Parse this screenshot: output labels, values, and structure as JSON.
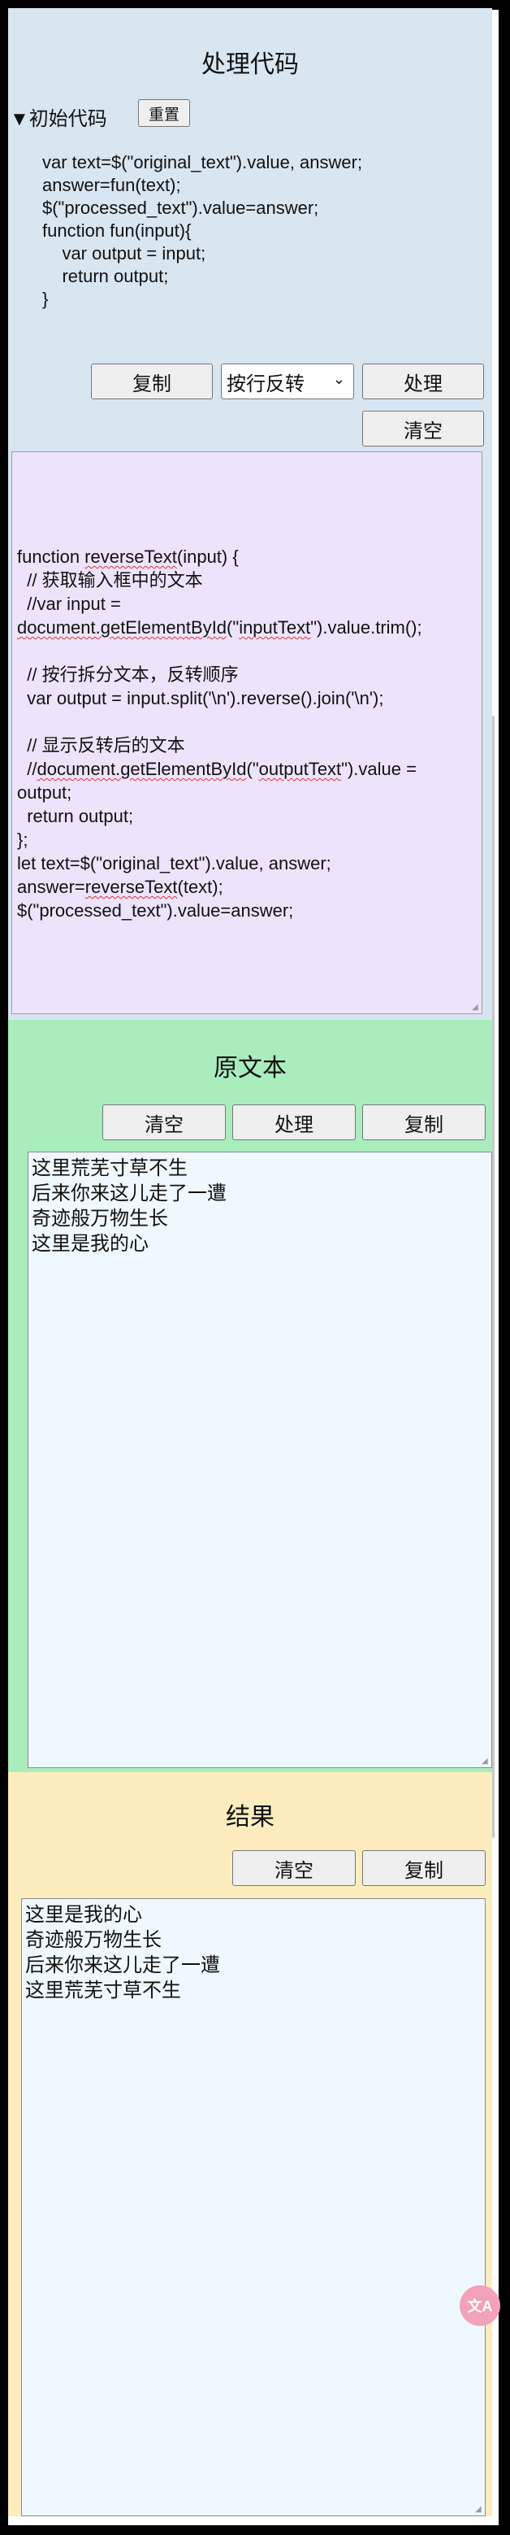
{
  "processing": {
    "title": "处理代码",
    "summary_label": "初始代码",
    "reset_label": "重置",
    "initial_code": "var text=$(\"original_text\").value, answer;\nanswer=fun(text);\n$(\"processed_text\").value=answer;\nfunction fun(input){\n    var output = input;\n    return output;\n}",
    "copy_label": "复制",
    "select_value": "按行反转",
    "process_label": "处理",
    "clear_label": "清空"
  },
  "editor": {
    "line1a": "function ",
    "line1b": "reverseText",
    "line1c": "(input) {",
    "line2": "  // 获取输入框中的文本",
    "line3": "  //var input =",
    "line4a": "document.getElementById",
    "line4b": "(\"",
    "line4c": "inputText",
    "line4d": "\").value.trim();",
    "line6": "  // 按行拆分文本，反转顺序",
    "line7": "  var output = input.split('\\n').reverse().join('\\n');",
    "line9": "  // 显示反转后的文本",
    "line10a": "  //",
    "line10b": "document.getElementById",
    "line10c": "(\"",
    "line10d": "outputText",
    "line10e": "\").value =",
    "line11": "output;",
    "line12": "  return output;",
    "line13": "};",
    "line14": "let text=$(\"original_text\").value, answer;",
    "line15a": "answer=",
    "line15b": "reverseText",
    "line15c": "(text);",
    "line16": "$(\"processed_text\").value=answer;"
  },
  "original": {
    "title": "原文本",
    "clear_label": "清空",
    "process_label": "处理",
    "copy_label": "复制",
    "text": "这里荒芜寸草不生\n后来你来这儿走了一遭\n奇迹般万物生长\n这里是我的心"
  },
  "result": {
    "title": "结果",
    "clear_label": "清空",
    "copy_label": "复制",
    "text": "这里是我的心\n奇迹般万物生长\n后来你来这儿走了一遭\n这里荒芜寸草不生"
  },
  "floating": {
    "label": "文A"
  }
}
